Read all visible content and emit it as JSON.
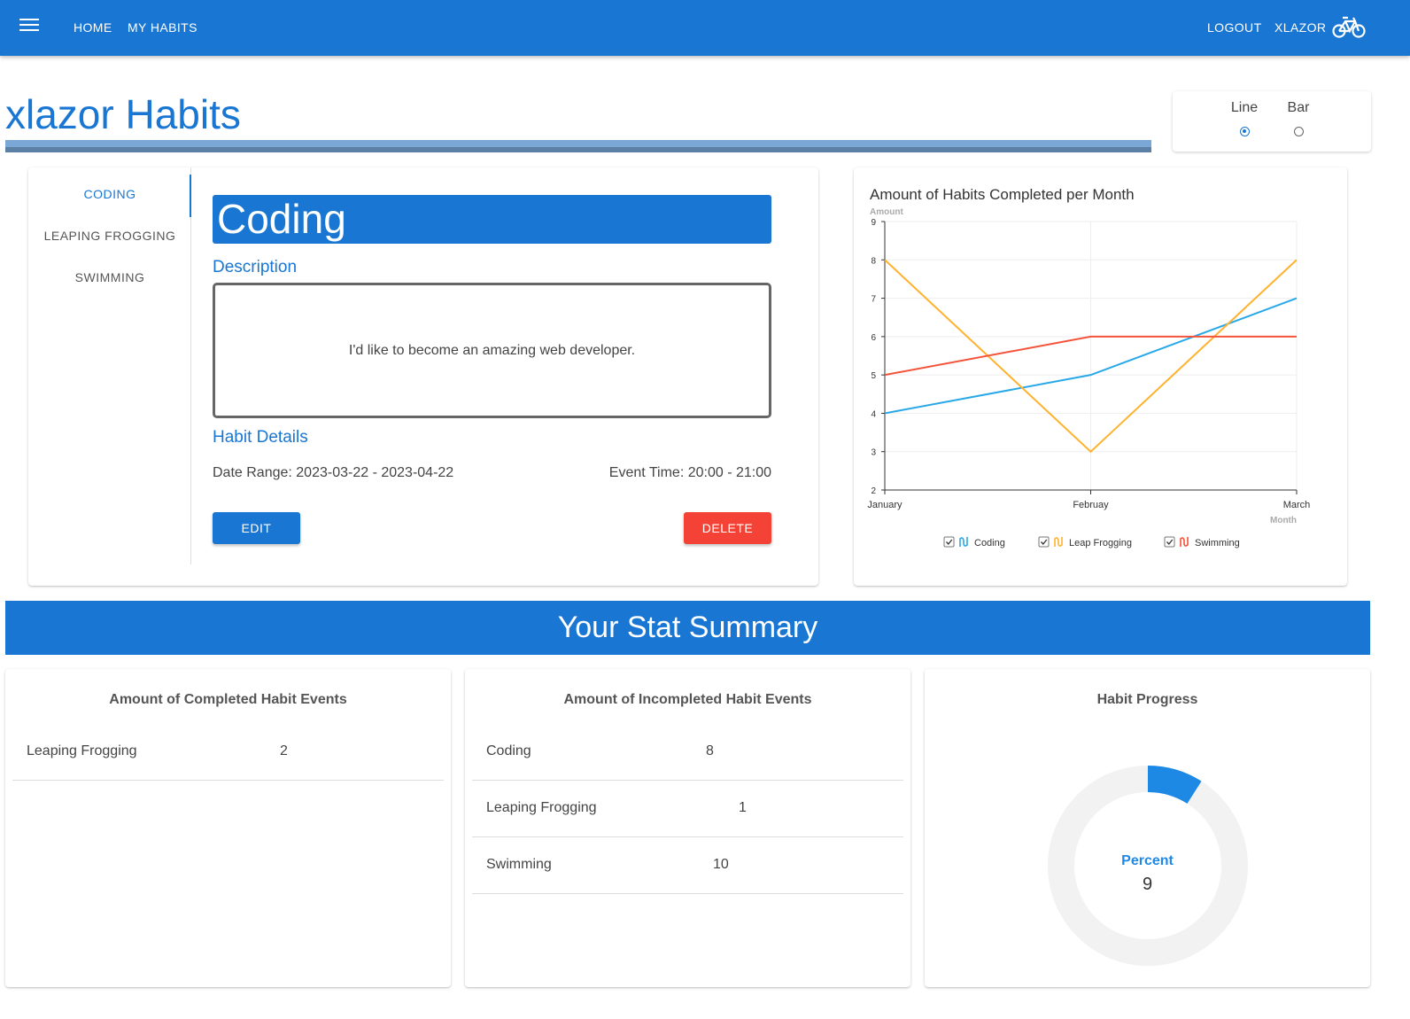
{
  "nav": {
    "home": "HOME",
    "my_habits": "MY HABITS",
    "logout": "LOGOUT",
    "user": "XLAZOR",
    "menu_icon": "menu-icon",
    "user_icon": "bicycle-icon"
  },
  "page": {
    "title": "xlazor Habits"
  },
  "chart_toggle": {
    "line_label": "Line",
    "bar_label": "Bar",
    "selected": "Line"
  },
  "habit_tabs": [
    "CODING",
    "LEAPING FROGGING",
    "SWIMMING"
  ],
  "habit": {
    "name": "Coding",
    "description_heading": "Description",
    "description": "I'd like to become an amazing web developer.",
    "details_heading": "Habit Details",
    "date_range": "Date Range: 2023-03-22 - 2023-04-22",
    "event_time": "Event Time: 20:00 - 21:00",
    "edit_label": "EDIT",
    "delete_label": "DELETE"
  },
  "colors": {
    "primary": "#1976d2",
    "delete": "#f44336",
    "coding": "#29a8e8",
    "leap": "#ffb22e",
    "swim": "#f4533a"
  },
  "chart_data": {
    "type": "line",
    "title": "Amount of Habits Completed per Month",
    "xlabel": "Month",
    "ylabel": "Amount",
    "categories": [
      "January",
      "Februay",
      "March"
    ],
    "ylim": [
      2,
      9
    ],
    "yticks": [
      "2",
      "3",
      "4",
      "5",
      "6",
      "7",
      "8",
      "9"
    ],
    "series": [
      {
        "name": "Coding",
        "values": [
          4,
          5,
          7
        ],
        "color": "#29a8e8"
      },
      {
        "name": "Leap Frogging",
        "values": [
          8,
          3,
          8
        ],
        "color": "#ffb22e"
      },
      {
        "name": "Swimming",
        "values": [
          5,
          6,
          6
        ],
        "color": "#f4533a"
      }
    ],
    "legend": "bottom",
    "grid": true
  },
  "summary": {
    "banner": "Your Stat Summary",
    "completed": {
      "title": "Amount of Completed Habit Events",
      "rows": [
        {
          "name": "Leaping Frogging",
          "value": "2"
        }
      ]
    },
    "incompleted": {
      "title": "Amount of Incompleted Habit Events",
      "rows": [
        {
          "name": "Coding",
          "value": "8"
        },
        {
          "name": "Leaping Frogging",
          "value": "1"
        },
        {
          "name": "Swimming",
          "value": "10"
        }
      ]
    },
    "progress": {
      "title": "Habit Progress",
      "label": "Percent",
      "value": "9",
      "percent": 9
    }
  }
}
